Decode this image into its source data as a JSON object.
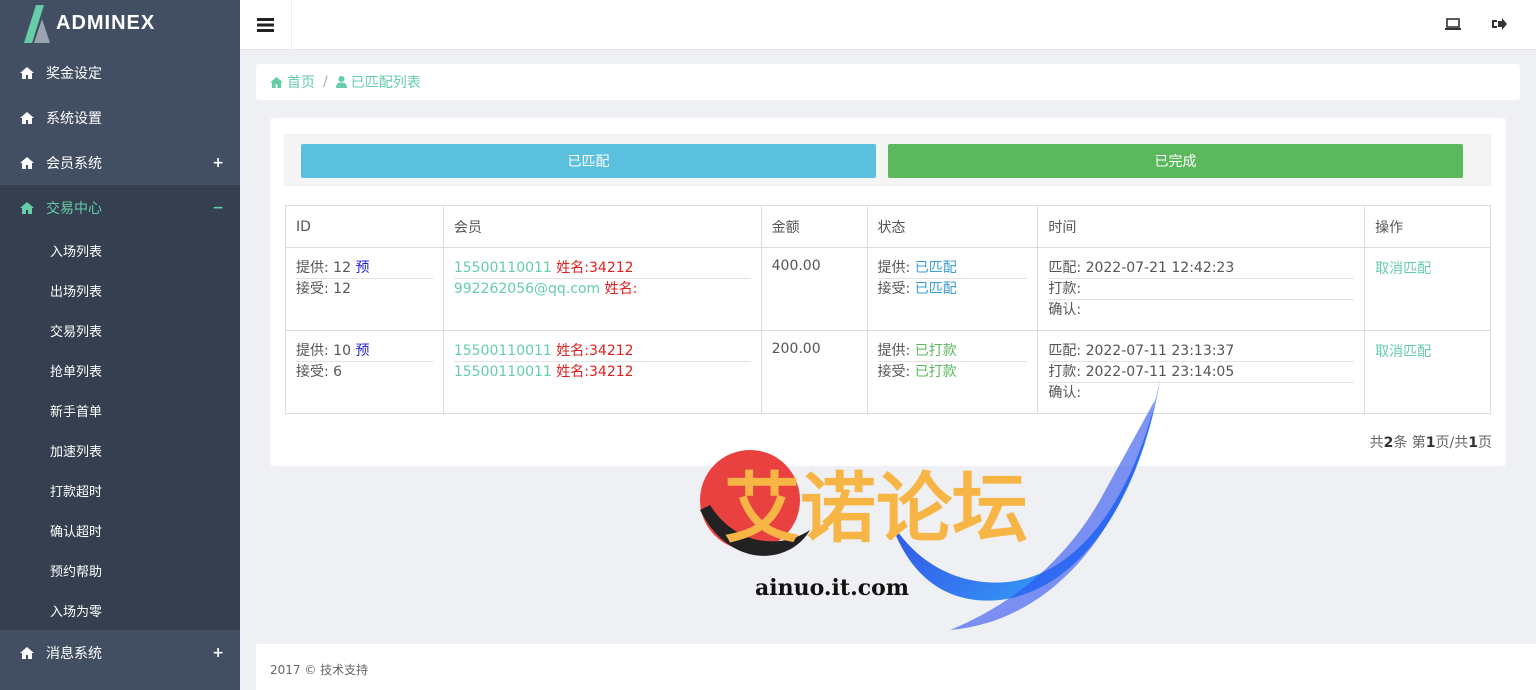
{
  "app": {
    "logo_text": "ADMINEX"
  },
  "sidebar": {
    "items": [
      {
        "label": "奖金设定",
        "sign": ""
      },
      {
        "label": "系统设置",
        "sign": ""
      },
      {
        "label": "会员系统",
        "sign": "+"
      },
      {
        "label": "交易中心",
        "sign": "−"
      }
    ],
    "submenu": [
      "入场列表",
      "出场列表",
      "交易列表",
      "抢单列表",
      "新手首单",
      "加速列表",
      "打款超时",
      "确认超时",
      "预约帮助",
      "入场为零"
    ],
    "after": {
      "label": "消息系统",
      "sign": "+"
    }
  },
  "breadcrumb": {
    "home": "首页",
    "sep": "/",
    "current": "已匹配列表"
  },
  "tabs": {
    "matched": "已匹配",
    "completed": "已完成"
  },
  "table": {
    "headers": [
      "ID",
      "会员",
      "金额",
      "状态",
      "时间",
      "操作"
    ],
    "rows": [
      {
        "provide_label": "提供:",
        "provide_id": "12",
        "pre": "预",
        "accept_label": "接受:",
        "accept_id": "12",
        "m1_phone": "15500110011",
        "m1_name": "姓名:34212",
        "m2_phone": "992262056@qq.com",
        "m2_name": "姓名:",
        "amount": "400.00",
        "st1_label": "提供:",
        "st1": "已匹配",
        "st2_label": "接受:",
        "st2": "已匹配",
        "t1_label": "匹配:",
        "t1": "2022-07-21 12:42:23",
        "t2_label": "打款:",
        "t2": "",
        "t3_label": "确认:",
        "t3": "",
        "action": "取消匹配"
      },
      {
        "provide_label": "提供:",
        "provide_id": "10",
        "pre": "预",
        "accept_label": "接受:",
        "accept_id": "6",
        "m1_phone": "15500110011",
        "m1_name": "姓名:34212",
        "m2_phone": "15500110011",
        "m2_name": "姓名:34212",
        "amount": "200.00",
        "st1_label": "提供:",
        "st1": "已打款",
        "st2_label": "接受:",
        "st2": "已打款",
        "t1_label": "匹配:",
        "t1": "2022-07-11 23:13:37",
        "t2_label": "打款:",
        "t2": "2022-07-11 23:14:05",
        "t3_label": "确认:",
        "t3": "",
        "action": "取消匹配"
      }
    ]
  },
  "pager": {
    "p1": "共",
    "total": "2",
    "p2": "条 第",
    "page": "1",
    "p3": "页/共",
    "pages": "1",
    "p4": "页"
  },
  "footer": {
    "text": "2017 © 技术支持"
  },
  "watermark": {
    "title": "艾诺论坛",
    "site": "ainuo.it.com"
  },
  "colors": {
    "sidebar": "#424f63",
    "sidebar_active": "#353f4f",
    "accent": "#65cea7",
    "btn_blue": "#5bc0de",
    "btn_green": "#5cb85c"
  },
  "icons": [
    "home-icon",
    "bars-icon",
    "laptop-icon",
    "sign-out-icon",
    "user-icon"
  ]
}
